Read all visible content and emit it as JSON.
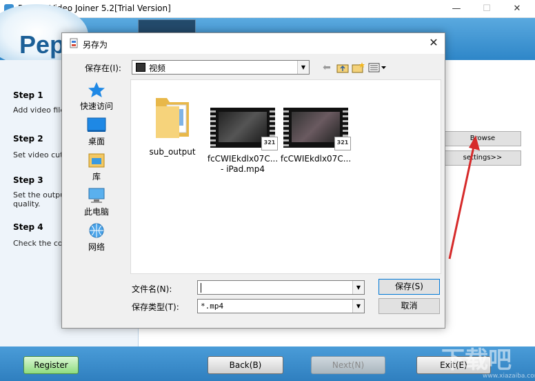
{
  "app": {
    "title": "Pepsky Video Joiner 5.2[Trial Version]",
    "logo_text": "PepS",
    "window_controls": {
      "minimize": "—",
      "maximize": "☐",
      "close": "✕"
    }
  },
  "steps": [
    {
      "title": "Step 1",
      "desc": "Add video files"
    },
    {
      "title": "Step 2",
      "desc": "Set video cutti"
    },
    {
      "title": "Step 3",
      "desc": "Set the output",
      "desc2": "quality."
    },
    {
      "title": "Step 4",
      "desc": "Check the conv"
    }
  ],
  "right_panel": {
    "browse_label": "Browse",
    "settings_label": "settings>>"
  },
  "bottom_bar": {
    "register_label": "Register",
    "back_label": "Back(B)",
    "next_label": "Next(N)",
    "exit_label": "Exit(E)"
  },
  "dialog": {
    "title": "另存为",
    "close": "✕",
    "save_in_label": "保存在(I):",
    "save_in_value": "视频",
    "places": [
      {
        "label": "快速访问",
        "icon": "star-icon"
      },
      {
        "label": "桌面",
        "icon": "desktop-icon"
      },
      {
        "label": "库",
        "icon": "library-icon"
      },
      {
        "label": "此电脑",
        "icon": "computer-icon"
      },
      {
        "label": "网络",
        "icon": "network-icon"
      }
    ],
    "files": [
      {
        "name": "sub_output",
        "name2": "",
        "type": "folder"
      },
      {
        "name": "fcCWIEkdlx07C...",
        "name2": "- iPad.mp4",
        "type": "video"
      },
      {
        "name": "fcCWIEkdlx07C...",
        "name2": "",
        "type": "video"
      }
    ],
    "video_badge": "321",
    "filename_label": "文件名(N):",
    "filename_value": "",
    "filetype_label": "保存类型(T):",
    "filetype_value": "*.mp4",
    "save_button": "保存(S)",
    "cancel_button": "取消"
  },
  "watermark": {
    "text": "下载吧",
    "url": "www.xiazaiba.com"
  },
  "colors": {
    "accent": "#2e86c8",
    "arrow": "#d62a2a"
  }
}
